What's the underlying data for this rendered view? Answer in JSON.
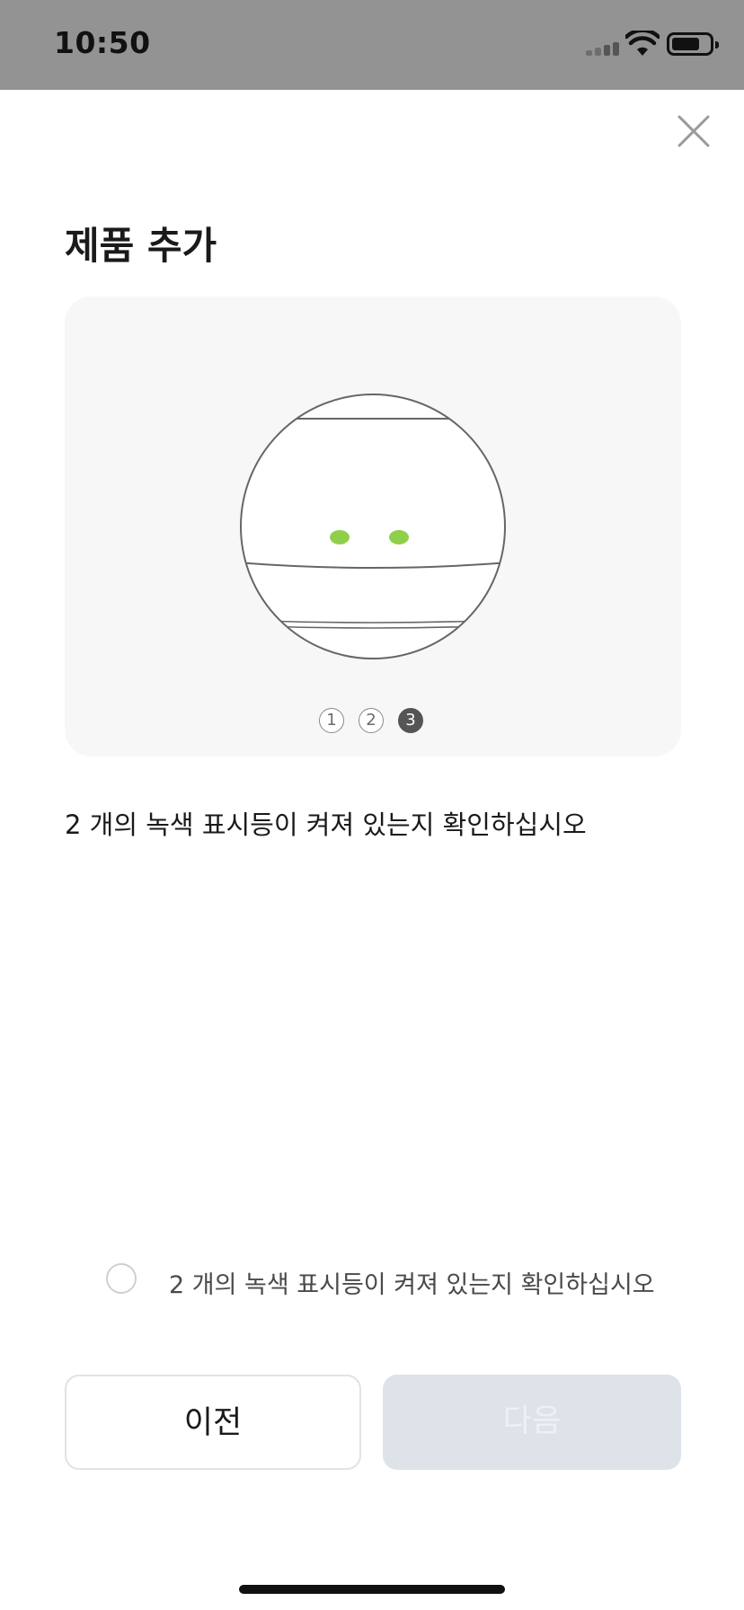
{
  "status_bar": {
    "time": "10:50"
  },
  "header": {
    "title": "제품 추가",
    "close_icon": "close-icon"
  },
  "illustration": {
    "indicator_color": "#8fcf4a",
    "steps": [
      "1",
      "2",
      "3"
    ],
    "active_step": "3"
  },
  "instruction": {
    "text": "2 개의 녹색 표시등이 켜져 있는지 확인하십시오"
  },
  "confirmation": {
    "label": "2 개의 녹색 표시등이 켜져 있는지 확인하십시오",
    "checked": false
  },
  "buttons": {
    "previous_label": "이전",
    "next_label": "다음",
    "next_enabled": false
  },
  "colors": {
    "status_bar_bg": "#939393",
    "card_bg": "#f7f7f7",
    "next_disabled_bg": "#dde3e9"
  }
}
